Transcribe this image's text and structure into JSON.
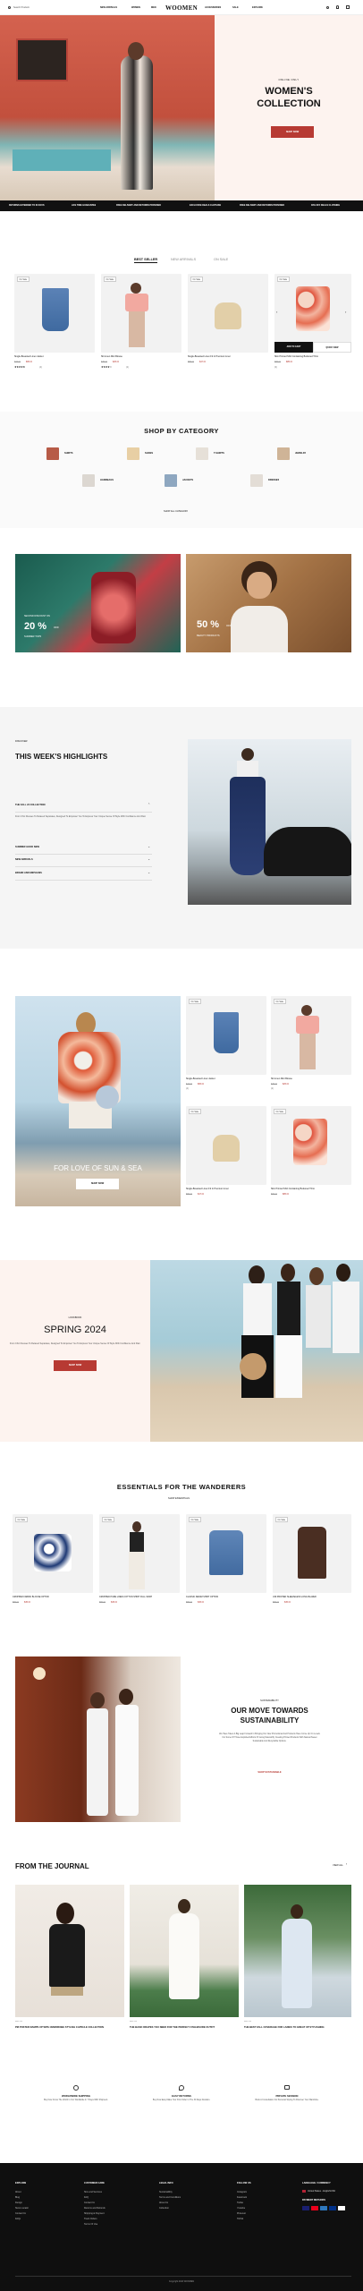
{
  "header": {
    "search_label": "Search Products",
    "nav_left": [
      "NEW ARRIVALS",
      "WOMEN",
      "MEN"
    ],
    "logo": "WOOMEN",
    "nav_right": [
      "ACCESSORIES",
      "SALE",
      "EXPLORE"
    ]
  },
  "hero": {
    "eyebrow": "ONLINE ONLY",
    "title_line1": "WOMEN'S",
    "title_line2": "COLLECTION",
    "cta": "SHOP NOW"
  },
  "ticker": [
    "RETURNS EXTENDED TO 60 DAYS",
    "LIFE TIME GUARANTEE",
    "FREE DELIVERY AND RETURNS PROVIDED",
    "EXCLUSIVE DEALS CLOTHING",
    "FREE DELIVERY AND RETURNS PROVIDED",
    "30% OFF DEALS CLOTHING"
  ],
  "tabs": [
    "BEST SELLER",
    "NEW ARRIVALS",
    "ON SALE"
  ],
  "bestsellers": [
    {
      "tag": "On Sale",
      "name": "Single-Breasted Linen Jacket",
      "old_price": "$73.00",
      "price": "$65.00",
      "rating": "★★★★★",
      "count": "(4)"
    },
    {
      "tag": "On Sale",
      "name": "Slit Linen Mini Blouse",
      "old_price": "$35.00",
      "price": "$25.00",
      "rating": "★★★★☆",
      "count": "(2)"
    },
    {
      "tag": "On Sale",
      "name": "Single-Breasted Linen Fit In Premium Linen",
      "old_price": "$55.00",
      "price": "$47.00",
      "rating": "",
      "count": ""
    },
    {
      "tag": "On Sale",
      "name": "Slim Printed Shirt Containing Buttoned Trims",
      "old_price": "$95.00",
      "price": "$85.00",
      "rating": "",
      "count": "(0)",
      "add_to_cart": "ADD TO CART",
      "quick_view": "QUICK VIEW"
    }
  ],
  "categories": {
    "title": "SHOP BY CATEGORY",
    "items": [
      "SHIRTS",
      "SHOES",
      "T-SHIRTS",
      "JEWELRY",
      "HANDBAGS",
      "JACKETS",
      "DRESSES"
    ],
    "view_all": "SHOP ALL CATEGORY"
  },
  "promos": [
    {
      "eyebrow": "SECOND DISCOUNT ON",
      "big": "20 %",
      "suffix": "OFF",
      "sub": "SUMMER TOPS"
    },
    {
      "big": "50 %",
      "suffix": "OFF",
      "sub": "BEAUTY PRODUCTS"
    }
  ],
  "highlights": {
    "eyebrow": "DISCOVER",
    "title": "THIS WEEK'S HIGHLIGHTS",
    "items": [
      "THE FALL 24 COLLECTION",
      "SUMMER GOOD NEW",
      "NEW ARRIVALS",
      "BRAND AND EMPHASIS"
    ],
    "open_text": "From Chic Dresses To Relaxed Separates, Designed To Empower You To Express Your Unique Sense Of Style With Confidence And Flair."
  },
  "love": {
    "title": "FOR LOVE OF SUN & SEA",
    "cta": "SHOP NOW",
    "products": [
      {
        "tag": "On Sale",
        "name": "Single-Breasted Linen Jacket",
        "old_price": "$73.00",
        "price": "$65.00",
        "count": "(4)"
      },
      {
        "tag": "On Sale",
        "name": "Slit Linen Mini Blouse",
        "old_price": "$35.00",
        "price": "$25.00",
        "count": "(2)"
      },
      {
        "tag": "On Sale",
        "name": "Single-Breasted Linen Fit In Premium Linen",
        "old_price": "$55.00",
        "price": "$47.00",
        "count": ""
      },
      {
        "tag": "On Sale",
        "name": "Slim Printed Shirt Containing Buttoned Trims",
        "old_price": "$95.00",
        "price": "$85.00",
        "count": ""
      }
    ]
  },
  "lookbook": {
    "eyebrow": "LOOKBOOK",
    "title": "SPRING 2024",
    "text": "From Chic Dresses To Relaxed Separates, Designed To Empower You To Express Your Unique Sense Of Style With Confidence And Flair.",
    "cta": "SHOP NOW"
  },
  "essentials": {
    "title": "ESSENTIALS FOR THE WANDERERS",
    "link": "SHOP ESSENTIALS",
    "products": [
      {
        "tag": "On Sale",
        "name": "CROPPED FABRIC BLOUSE OPTION",
        "old_price": "$55.00",
        "price": "$45.00"
      },
      {
        "tag": "On Sale",
        "name": "CROPPED PURE LINEN COTTON SHIRT FULL SKIRT",
        "old_price": "$55.00",
        "price": "$45.00"
      },
      {
        "tag": "On Sale",
        "name": "CLASSIC DENIM SHIRT OPTION",
        "old_price": "$55.00",
        "price": "$45.00"
      },
      {
        "tag": "On Sale",
        "name": "UNI PRINTED SLEEVELESS LONG BLAZER",
        "old_price": "$55.00",
        "price": "$45.00"
      }
    ]
  },
  "sustain": {
    "eyebrow": "SUSTAINABILITY",
    "title_line1": "OUR MOVE TOWARDS",
    "title_line2": "SUSTAINABILITY",
    "text": "We Have Taken A Big Leap Forward In Bringing Our New Promotional And Products Have Come Up On Levels For Some Of Those Exploited Efforts Of Going Natural By Creating Printed Products With Natural Sweet Sustainable And Recyclable Options.",
    "cta": "SHOP SUSTAINABLE"
  },
  "journal": {
    "title": "FROM THE JOURNAL",
    "link": "VIEW ALL",
    "posts": [
      {
        "date": "MAY 24",
        "title": "PM POSTER RAMPS UP WITH WARDROBE STYLISH CAPSULE COLLECTION"
      },
      {
        "date": "MAY 24",
        "title": "THE BASIC DRAPES YOU NEED FOR THE PERFECT ATHLEISURE OUTFIT"
      },
      {
        "date": "MAY 24",
        "title": "THE BEST FALL COVERAGE FOR LADIES TO GREAT UP STYLISHING"
      }
    ]
  },
  "features": [
    {
      "title": "WORLDWIDE SHIPPING",
      "text": "Buy Now Cross The World In Our Worldwide In 7 Days With Shipment."
    },
    {
      "title": "EASY RETURNS",
      "text": "Buy Now Easy Make Your First Order In The 30 Days Duration."
    },
    {
      "title": "PRIVATE SESSION",
      "text": "Book A Consultation For Personal Styling To Discover Your Wardrobe."
    }
  ],
  "footer": {
    "cols": [
      {
        "title": "EXPLORE",
        "links": [
          "About",
          "Blog",
          "Design",
          "Store Locator",
          "Contact Us",
          "FAQs"
        ]
      },
      {
        "title": "CUSTOMER CARE",
        "links": [
          "Size and Services",
          "FAQ",
          "Contact Us",
          "Returns and Refunds",
          "Shipping & Payment",
          "Track Orders",
          "Terms Of Use"
        ]
      },
      {
        "title": "LEGAL INFO",
        "links": [
          "Sustainability",
          "Terms and Conditions",
          "About Us",
          "Collection"
        ]
      },
      {
        "title": "FOLLOW US",
        "links": [
          "Instagram",
          "Facebook",
          "Twitter",
          "Youtube",
          "Pinterest",
          "TikTok"
        ]
      }
    ],
    "lang_title": "LANGUAGE / CURRENCY",
    "lang_value": "United States - English/USD",
    "payment_title": "PAYMENT METHODS",
    "copyright": "Copyright 2024 WOOMEN"
  }
}
